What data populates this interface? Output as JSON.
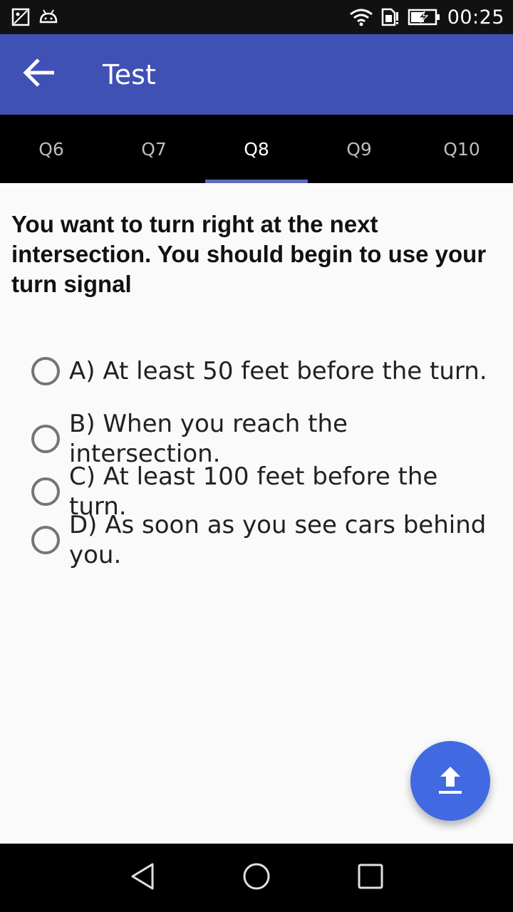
{
  "status_bar": {
    "time": "00:25",
    "icons": [
      "image-icon",
      "android-icon",
      "wifi-icon",
      "sim-icon",
      "battery-charging-icon"
    ]
  },
  "app_bar": {
    "title": "Test",
    "back_icon": "arrow-back-icon"
  },
  "tabs": [
    {
      "label": "Q6",
      "active": false
    },
    {
      "label": "Q7",
      "active": false
    },
    {
      "label": "Q8",
      "active": true
    },
    {
      "label": "Q9",
      "active": false
    },
    {
      "label": "Q10",
      "active": false
    }
  ],
  "question": {
    "text": "You want to turn right at the next intersection. You should begin to use your turn signal"
  },
  "options": [
    {
      "label": "A) At least 50 feet before the turn."
    },
    {
      "label": "B) When you reach the intersection."
    },
    {
      "label": "C) At least 100 feet before the turn."
    },
    {
      "label": "D) As soon as you see cars behind you."
    }
  ],
  "fab": {
    "icon": "upload-icon"
  },
  "nav_bar": {
    "icons": [
      "nav-back-icon",
      "nav-home-icon",
      "nav-recents-icon"
    ]
  },
  "colors": {
    "app_bar": "#3f51b5",
    "fab": "#4169e1",
    "tab_indicator": "#5c6bc0"
  }
}
